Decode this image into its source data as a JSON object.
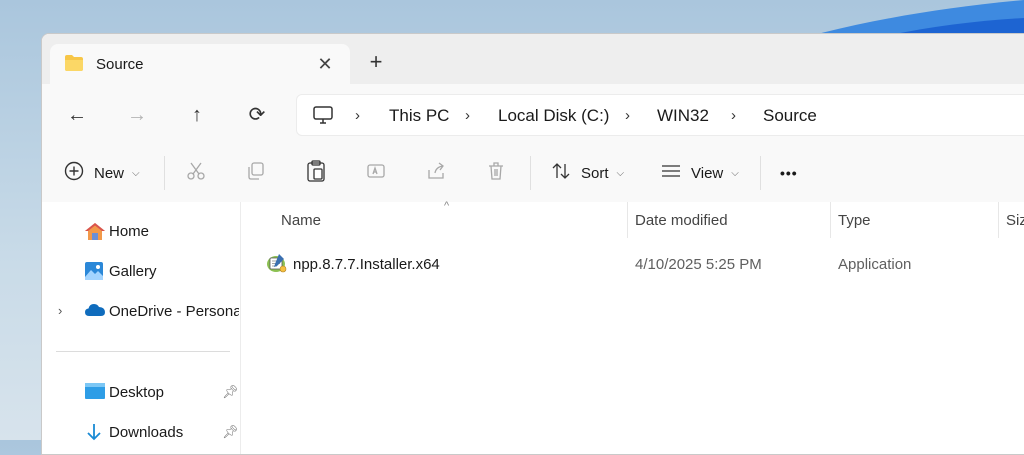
{
  "tab": {
    "title": "Source",
    "close": "✕",
    "new": "+"
  },
  "nav": {
    "back": "←",
    "forward": "→",
    "up": "↑",
    "refresh": "⟳"
  },
  "breadcrumbs": [
    {
      "label": "This PC"
    },
    {
      "label": "Local Disk (C:)"
    },
    {
      "label": "WIN32"
    },
    {
      "label": "Source"
    }
  ],
  "toolbar": {
    "new_label": "New",
    "sort_label": "Sort",
    "view_label": "View",
    "more": "•••"
  },
  "sidebar": {
    "items": [
      {
        "label": "Home",
        "icon": "home-icon"
      },
      {
        "label": "Gallery",
        "icon": "gallery-icon"
      },
      {
        "label": "OneDrive - Personal",
        "icon": "onedrive-icon"
      },
      {
        "label": "Desktop",
        "icon": "desktop-icon"
      },
      {
        "label": "Downloads",
        "icon": "downloads-icon"
      }
    ]
  },
  "columns": {
    "name": "Name",
    "date_modified": "Date modified",
    "type": "Type",
    "size": "Size"
  },
  "files": [
    {
      "name": "npp.8.7.7.Installer.x64",
      "date_modified": "4/10/2025 5:25 PM",
      "type": "Application"
    }
  ],
  "colors": {
    "accent": "#0067c0",
    "folder": "#f7c647",
    "desktop_bg": "#aac6dd"
  }
}
